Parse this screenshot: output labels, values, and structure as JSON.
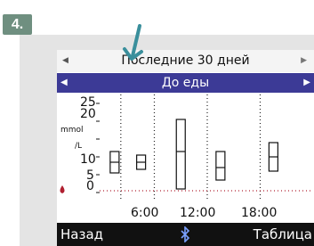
{
  "step": {
    "number": "4."
  },
  "header": {
    "title": "Последние 30 дней",
    "subtitle": "До еды"
  },
  "chart_data": {
    "type": "box",
    "title": "Последние 30 дней",
    "subtitle": "До еды",
    "ylabel_parts": [
      "mmol",
      "/L"
    ],
    "y_ticks": [
      "25",
      "20",
      "15",
      "10",
      "5",
      "0"
    ],
    "x_ticks": [
      "6:00",
      "12:00",
      "18:00"
    ],
    "ylim": [
      0,
      25
    ],
    "boxes": [
      {
        "x": 1.5,
        "low": 5.5,
        "high": 11.5,
        "median": 8.5
      },
      {
        "x": 4.5,
        "low": 6.5,
        "high": 10.5,
        "median": 8.5
      },
      {
        "x": 9.0,
        "low": 1.0,
        "high": 20.5,
        "median": 11.5
      },
      {
        "x": 13.5,
        "low": 3.5,
        "high": 11.5,
        "median": 7.0
      },
      {
        "x": 19.5,
        "low": 6.0,
        "high": 14.0,
        "median": 10.0
      }
    ],
    "low_threshold": 0.5,
    "grid": "dotted"
  },
  "footer": {
    "left_label": "Назад",
    "right_label": "Таблица"
  },
  "colors": {
    "badge": "#6f8f80",
    "subtitle_bar": "#3c3a96",
    "footer_bar": "#111111",
    "arrow": "#3a8f9c",
    "low_marker": "#b02030"
  },
  "icons": {
    "left_arrow": "triangle-left-icon",
    "right_arrow": "triangle-right-icon",
    "bluetooth": "bluetooth-icon",
    "low_marker": "blood-drop-icon",
    "pointer": "down-arrow-icon"
  }
}
